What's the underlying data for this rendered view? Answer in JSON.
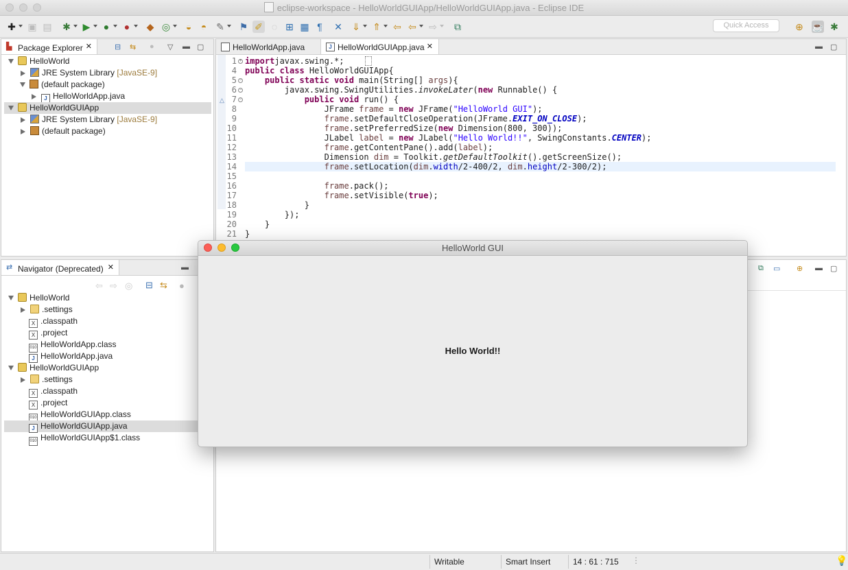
{
  "window": {
    "title": "eclipse-workspace - HelloWorldGUIApp/HelloWorldGUIApp.java - Eclipse IDE"
  },
  "toolbar": {
    "quick_access_placeholder": "Quick Access"
  },
  "package_explorer": {
    "tab_label": "Package Explorer",
    "tree": [
      {
        "label": "HelloWorld",
        "suffix": ""
      },
      {
        "label": "JRE System Library",
        "suffix": "[JavaSE-9]"
      },
      {
        "label": "(default package)",
        "suffix": ""
      },
      {
        "label": "HelloWorldApp.java",
        "suffix": ""
      },
      {
        "label": "HelloWorldGUIApp",
        "suffix": ""
      },
      {
        "label": "JRE System Library",
        "suffix": "[JavaSE-9]"
      },
      {
        "label": "(default package)",
        "suffix": ""
      }
    ]
  },
  "navigator": {
    "tab_label": "Navigator (Deprecated)",
    "tree": [
      {
        "label": "HelloWorld"
      },
      {
        "label": ".settings"
      },
      {
        "label": ".classpath"
      },
      {
        "label": ".project"
      },
      {
        "label": "HelloWorldApp.class"
      },
      {
        "label": "HelloWorldApp.java"
      },
      {
        "label": "HelloWorldGUIApp"
      },
      {
        "label": ".settings"
      },
      {
        "label": ".classpath"
      },
      {
        "label": ".project"
      },
      {
        "label": "HelloWorldGUIApp.class"
      },
      {
        "label": "HelloWorldGUIApp.java"
      },
      {
        "label": "HelloWorldGUIApp$1.class"
      }
    ]
  },
  "editor": {
    "tabs": [
      {
        "label": "HelloWorldApp.java"
      },
      {
        "label": "HelloWorldGUIApp.java"
      }
    ],
    "line_numbers": [
      "1",
      "4",
      "5",
      "6",
      "7",
      "8",
      "9",
      "10",
      "11",
      "12",
      "13",
      "14",
      "15",
      "16",
      "17",
      "18",
      "19",
      "20",
      "21"
    ],
    "code": [
      {
        "t": [
          [
            "kw",
            "import"
          ],
          [
            "",
            "javax.swing.*;"
          ]
        ]
      },
      {
        "t": [
          [
            "kw",
            "public class"
          ],
          [
            "",
            " HelloWorldGUIApp{"
          ]
        ]
      },
      {
        "t": [
          [
            "",
            "    "
          ],
          [
            "kw",
            "public static void"
          ],
          [
            "",
            " main(String[] "
          ],
          [
            "var",
            "args"
          ],
          [
            "",
            "){"
          ]
        ]
      },
      {
        "t": [
          [
            "",
            "        javax.swing.SwingUtilities."
          ],
          [
            "it",
            "invokeLater"
          ],
          [
            "",
            "("
          ],
          [
            "kw",
            "new"
          ],
          [
            "",
            " Runnable() {"
          ]
        ]
      },
      {
        "t": [
          [
            "",
            "            "
          ],
          [
            "kw",
            "public void"
          ],
          [
            "",
            " run() {"
          ]
        ]
      },
      {
        "t": [
          [
            "",
            "                JFrame "
          ],
          [
            "var",
            "frame"
          ],
          [
            "",
            " = "
          ],
          [
            "kw",
            "new"
          ],
          [
            "",
            " JFrame("
          ],
          [
            "str",
            "\"HelloWorld GUI\""
          ],
          [
            "",
            ");"
          ]
        ]
      },
      {
        "t": [
          [
            "",
            "                "
          ],
          [
            "var",
            "frame"
          ],
          [
            "",
            ".setDefaultCloseOperation(JFrame."
          ],
          [
            "fldi",
            "EXIT_ON_CLOSE"
          ],
          [
            "",
            ");"
          ]
        ]
      },
      {
        "t": [
          [
            "",
            "                "
          ],
          [
            "var",
            "frame"
          ],
          [
            "",
            ".setPreferredSize("
          ],
          [
            "kw",
            "new"
          ],
          [
            "",
            " Dimension(800, 300));"
          ]
        ]
      },
      {
        "t": [
          [
            "",
            "                JLabel "
          ],
          [
            "var",
            "label"
          ],
          [
            "",
            " = "
          ],
          [
            "kw",
            "new"
          ],
          [
            "",
            " JLabel("
          ],
          [
            "str",
            "\"Hello World!!\""
          ],
          [
            "",
            ", SwingConstants."
          ],
          [
            "fldi",
            "CENTER"
          ],
          [
            "",
            ");"
          ]
        ]
      },
      {
        "t": [
          [
            "",
            "                "
          ],
          [
            "var",
            "frame"
          ],
          [
            "",
            ".getContentPane().add("
          ],
          [
            "var",
            "label"
          ],
          [
            "",
            ");"
          ]
        ]
      },
      {
        "t": [
          [
            "",
            "                Dimension "
          ],
          [
            "var",
            "dim"
          ],
          [
            "",
            " = Toolkit."
          ],
          [
            "it",
            "getDefaultToolkit"
          ],
          [
            "",
            "().getScreenSize();"
          ]
        ]
      },
      {
        "t": [
          [
            "",
            "                "
          ],
          [
            "var",
            "frame"
          ],
          [
            "",
            ".setLocation("
          ],
          [
            "var",
            "dim"
          ],
          [
            "",
            "."
          ],
          [
            "fld",
            "width"
          ],
          [
            "",
            "/2-400/2, "
          ],
          [
            "var",
            "dim"
          ],
          [
            "",
            "."
          ],
          [
            "fld",
            "height"
          ],
          [
            "",
            "/2-300/2);"
          ]
        ]
      },
      {
        "t": [
          [
            "",
            ""
          ]
        ]
      },
      {
        "t": [
          [
            "",
            "                "
          ],
          [
            "var",
            "frame"
          ],
          [
            "",
            ".pack();"
          ]
        ]
      },
      {
        "t": [
          [
            "",
            "                "
          ],
          [
            "var",
            "frame"
          ],
          [
            "",
            ".setVisible("
          ],
          [
            "kw",
            "true"
          ],
          [
            "",
            ");"
          ]
        ]
      },
      {
        "t": [
          [
            "",
            "            }"
          ]
        ]
      },
      {
        "t": [
          [
            "",
            "        });"
          ]
        ]
      },
      {
        "t": [
          [
            "",
            "    }"
          ]
        ]
      },
      {
        "t": [
          [
            "",
            "}"
          ]
        ]
      }
    ]
  },
  "status": {
    "mode": "Writable",
    "insert": "Smart Insert",
    "position": "14 : 61 : 715"
  },
  "swing_window": {
    "title": "HelloWorld GUI",
    "label": "Hello World!!"
  }
}
